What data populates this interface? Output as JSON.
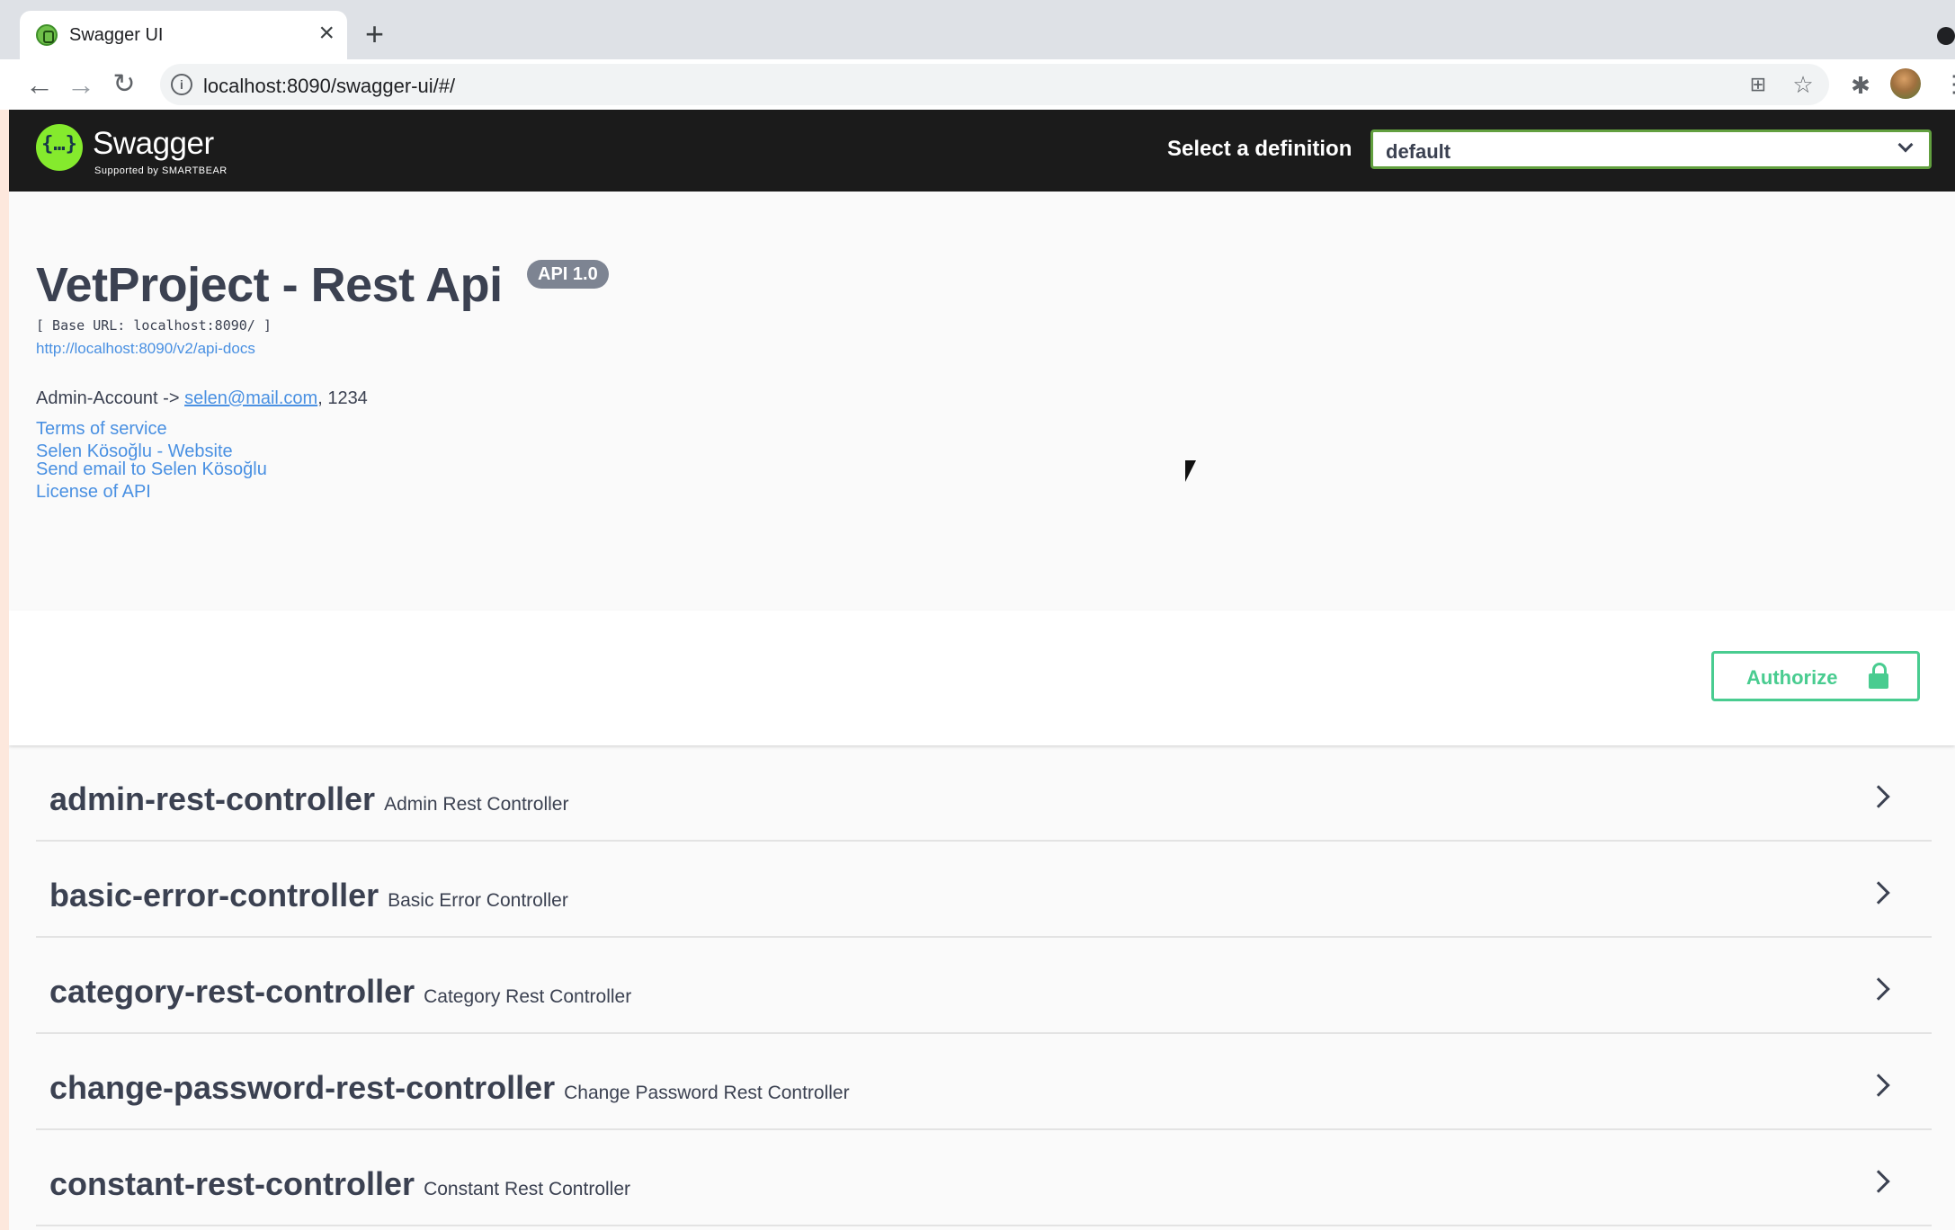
{
  "browser": {
    "tab_title": "Swagger UI",
    "tab_close": "×",
    "new_tab": "+",
    "url": "localhost:8090/swagger-ui/#/"
  },
  "swagger": {
    "brand": "Swagger",
    "brand_sub": "Supported by SMARTBEAR",
    "definition_label": "Select a definition",
    "definition_value": "default"
  },
  "info": {
    "title": "VetProject - Rest Api",
    "version": "API 1.0",
    "base_url": "[ Base URL: localhost:8090/ ]",
    "docs_url": "http://localhost:8090/v2/api-docs",
    "description_prefix": "Admin-Account -> ",
    "description_email": "selen@mail.com",
    "description_suffix": ", 1234",
    "terms": "Terms of service",
    "website": "Selen Kösoğlu - Website",
    "email": "Send email to Selen Kösoğlu",
    "license": "License of API"
  },
  "authorize_label": "Authorize",
  "tags": [
    {
      "name": "admin-rest-controller",
      "desc": "Admin Rest Controller"
    },
    {
      "name": "basic-error-controller",
      "desc": "Basic Error Controller"
    },
    {
      "name": "category-rest-controller",
      "desc": "Category Rest Controller"
    },
    {
      "name": "change-password-rest-controller",
      "desc": "Change Password Rest Controller"
    },
    {
      "name": "constant-rest-controller",
      "desc": "Constant Rest Controller"
    }
  ],
  "colors": {
    "topbar": "#1b1b1b",
    "logo": "#85ea2d",
    "link": "#4990e2",
    "authorize": "#49cc90",
    "text": "#3b4151"
  }
}
